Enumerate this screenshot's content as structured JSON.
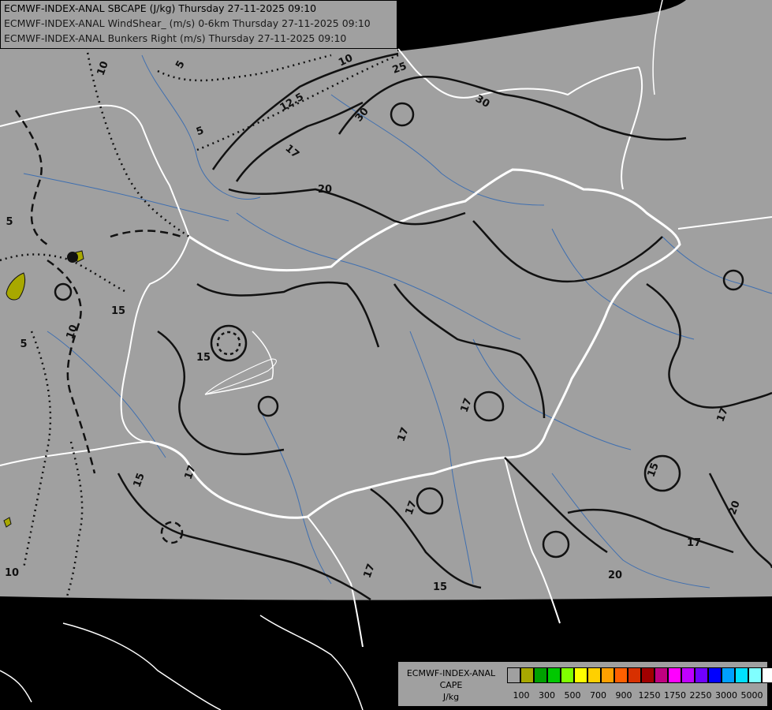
{
  "titles": [
    "ECMWF-INDEX-ANAL SBCAPE (J/kg) Thursday 27-11-2025 09:10",
    "ECMWF-INDEX-ANAL WindShear_ (m/s) 0-6km Thursday 27-11-2025 09:10",
    "ECMWF-INDEX-ANAL Bunkers Right (m/s) Thursday 27-11-2025 09:10"
  ],
  "colors": {
    "background": "#000000",
    "land": "#a0a0a0",
    "contour": "#111111",
    "borders": "#ffffff",
    "rivers": "#3f6fb0",
    "cape_low": "#a8a800"
  },
  "contour_labels": [
    {
      "text": "10"
    },
    {
      "text": "5"
    },
    {
      "text": "25"
    },
    {
      "text": "30"
    },
    {
      "text": "30"
    },
    {
      "text": "10"
    },
    {
      "text": "12.5"
    },
    {
      "text": "5"
    },
    {
      "text": "17"
    },
    {
      "text": "20"
    },
    {
      "text": "5"
    },
    {
      "text": "15"
    },
    {
      "text": "10"
    },
    {
      "text": "5"
    },
    {
      "text": "15"
    },
    {
      "text": "17"
    },
    {
      "text": "15"
    },
    {
      "text": "17"
    },
    {
      "text": "17"
    },
    {
      "text": "17"
    },
    {
      "text": "17"
    },
    {
      "text": "15"
    },
    {
      "text": "20"
    },
    {
      "text": "17"
    },
    {
      "text": "15"
    },
    {
      "text": "20"
    },
    {
      "text": "10"
    },
    {
      "text": "17"
    }
  ],
  "legend": {
    "title_lines": [
      "ECMWF-INDEX-ANAL",
      "CAPE",
      "J/kg"
    ],
    "colors": [
      "#a0a0a0",
      "#a8a800",
      "#00a000",
      "#00c800",
      "#80ff00",
      "#ffff00",
      "#ffd000",
      "#ffa000",
      "#ff6000",
      "#d83000",
      "#a00000",
      "#c00080",
      "#ff00ff",
      "#c000ff",
      "#7000ff",
      "#0000ff",
      "#00a0ff",
      "#00e0ff",
      "#80ffff",
      "#ffffff"
    ],
    "tick_labels": [
      "100",
      "300",
      "500",
      "700",
      "900",
      "1250",
      "1750",
      "2250",
      "3000",
      "5000"
    ]
  }
}
